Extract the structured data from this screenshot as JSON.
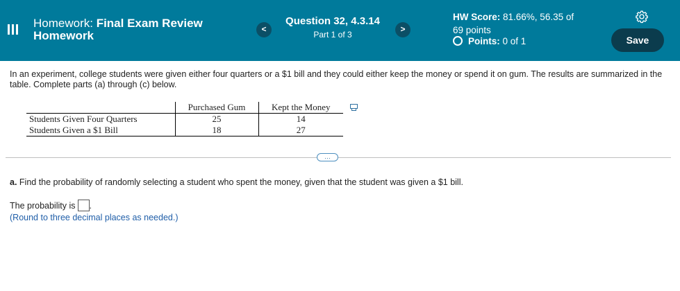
{
  "header": {
    "homework_prefix": "Homework: ",
    "homework_name_line1": "Final Exam Review",
    "homework_name_line2": "Homework",
    "question_title": "Question 32, 4.3.14",
    "question_part": "Part 1 of 3",
    "prev_label": "<",
    "next_label": ">",
    "hw_score_label": "HW Score:",
    "hw_score_value": " 81.66%, 56.35 of",
    "hw_score_line2": "69 points",
    "points_label": "Points:",
    "points_value": " 0 of 1",
    "save_label": "Save",
    "colors": {
      "bar": "#007a9b",
      "buttons": "#0b3c4d"
    }
  },
  "problem": {
    "intro": "In an experiment, college students were given either four quarters or a $1 bill and they could either keep the money or spend it on gum. The results are summarized in the table. Complete parts (a) through (c) below."
  },
  "table": {
    "columns": [
      "Purchased Gum",
      "Kept the Money"
    ],
    "rows": [
      {
        "label": "Students Given Four Quarters",
        "values": [
          "25",
          "14"
        ]
      },
      {
        "label": "Students Given a $1 Bill",
        "values": [
          "18",
          "27"
        ]
      }
    ]
  },
  "more_label": "…",
  "part_a": {
    "label": "a.",
    "text": " Find the probability of randomly selecting a student who spent the money, given that the student was given a $1 bill.",
    "answer_prefix": "The probability is",
    "answer_suffix": ".",
    "answer_value": "",
    "hint": "(Round to three decimal places as needed.)"
  }
}
